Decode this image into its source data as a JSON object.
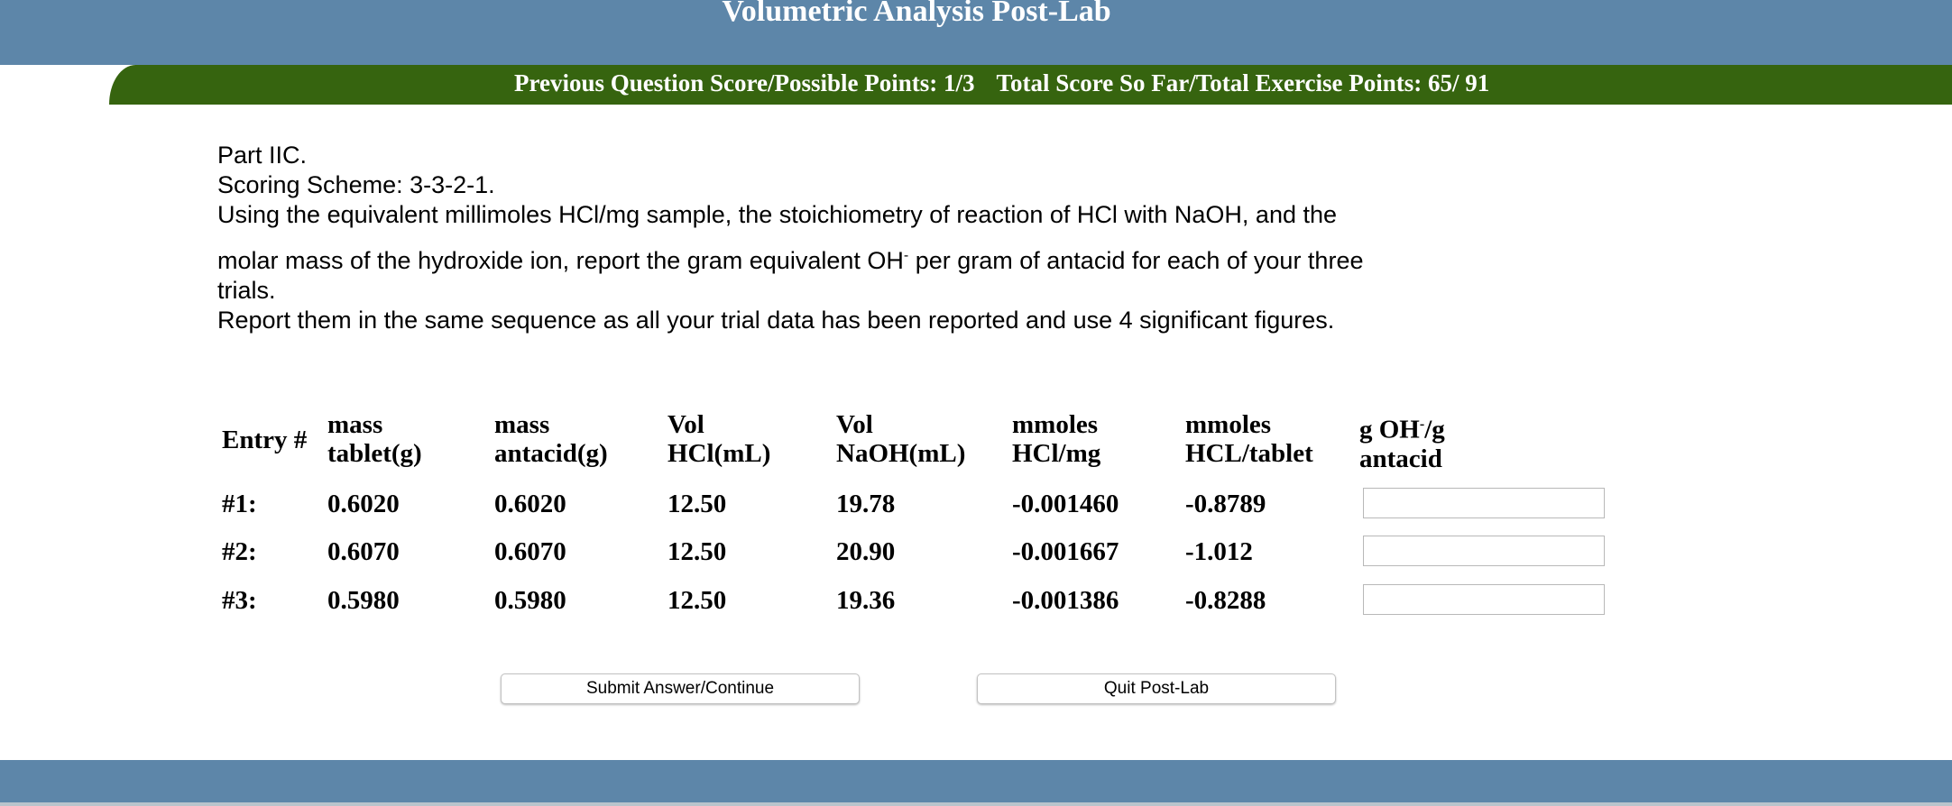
{
  "header": {
    "title": "Volumetric Analysis Post-Lab"
  },
  "score_bar": {
    "previous": "Previous Question Score/Possible Points: 1/3",
    "total": "Total Score So Far/Total Exercise Points: 65/ 91"
  },
  "instructions": {
    "part": "Part IIC.",
    "scoring": "Scoring Scheme: 3-3-2-1.",
    "line1": "Using the equivalent millimoles HCl/mg sample, the stoichiometry of reaction of HCl with NaOH, and the",
    "line2a": "molar mass of the hydroxide ion, report the gram equivalent OH",
    "line2_sup": "-",
    "line2b": " per gram of antacid for each of your three",
    "line3": "trials.",
    "line4": "Report them in the same sequence as all your trial data has been reported and use 4 significant figures."
  },
  "table": {
    "headers": [
      {
        "l1": "Entry #",
        "l2": ""
      },
      {
        "l1": "mass",
        "l2": "tablet(g)"
      },
      {
        "l1": "mass",
        "l2": "antacid(g)"
      },
      {
        "l1": "Vol",
        "l2": "HCl(mL)"
      },
      {
        "l1": "Vol",
        "l2": "NaOH(mL)"
      },
      {
        "l1": "mmoles",
        "l2": "HCl/mg"
      },
      {
        "l1": "mmoles",
        "l2": "HCL/tablet"
      },
      {
        "l1": "g OH",
        "sup": "-",
        "l1b": "/g",
        "l2": "antacid"
      }
    ],
    "rows": [
      {
        "entry": "#1:",
        "cells": [
          "0.6020",
          "0.6020",
          "12.50",
          "19.78",
          "-0.001460",
          "-0.8789"
        ],
        "answer": ""
      },
      {
        "entry": "#2:",
        "cells": [
          "0.6070",
          "0.6070",
          "12.50",
          "20.90",
          "-0.001667",
          "-1.012"
        ],
        "answer": ""
      },
      {
        "entry": "#3:",
        "cells": [
          "0.5980",
          "0.5980",
          "12.50",
          "19.36",
          "-0.001386",
          "-0.8288"
        ],
        "answer": ""
      }
    ]
  },
  "buttons": {
    "submit": "Submit Answer/Continue",
    "quit": "Quit Post-Lab"
  }
}
